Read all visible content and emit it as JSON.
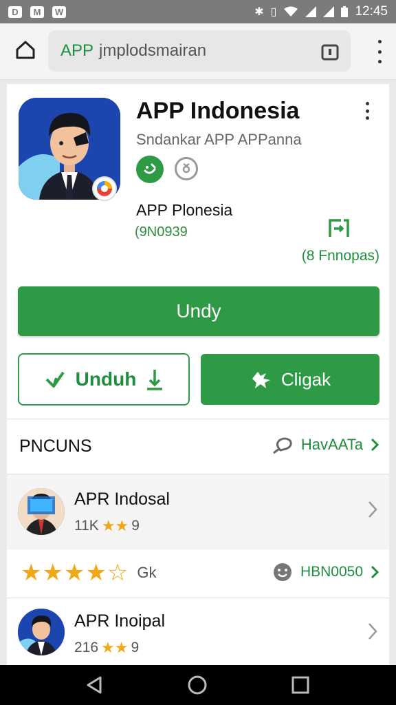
{
  "status_bar": {
    "icons": [
      "sim-icon",
      "mail-icon",
      "chat-icon"
    ],
    "notif_letters": [
      "D",
      "M",
      "W"
    ],
    "time": "12:45",
    "right_icons": [
      "bluetooth-icon",
      "vibrate-icon",
      "wifi-icon",
      "signal-icon",
      "signal-icon",
      "battery-icon"
    ]
  },
  "browser": {
    "url_highlight": "APP",
    "url_rest": "jmplodsmairan"
  },
  "app": {
    "title": "APP Indonesia",
    "developer": "Sndankar APP APPanna",
    "subtitle": "APP Plonesia",
    "code": "(9N0939",
    "share_label": "(8 Fnnopas)",
    "primary_button": "Undy",
    "download_button": "Unduh",
    "secondary_button": "Cligak"
  },
  "section": {
    "title": "PNCUNS",
    "link": "HavAATa"
  },
  "related": [
    {
      "title": "APR Indosal",
      "meta": "11K",
      "rating": "9"
    },
    {
      "title": "APR Inoipal",
      "meta": "216",
      "rating": "9"
    }
  ],
  "review": {
    "count": "Gk",
    "link": "HBN0050"
  },
  "colors": {
    "accent": "#2e9a45",
    "accent_text": "#1e8e3e",
    "star": "#f0a818"
  }
}
